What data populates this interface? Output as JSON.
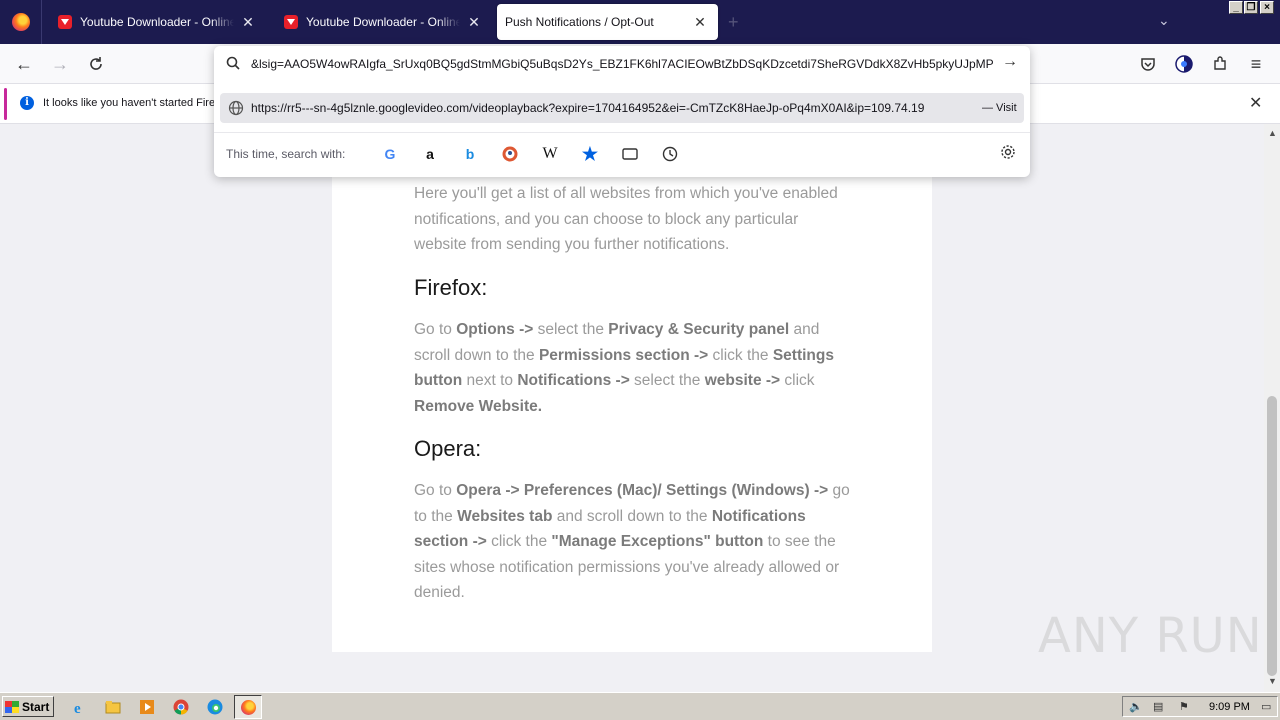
{
  "browser": {
    "tabs": [
      {
        "title": "Youtube Downloader - Online Youtube",
        "active": false
      },
      {
        "title": "Youtube Downloader - Online Youtube",
        "active": false
      },
      {
        "title": "Push Notifications / Opt-Out",
        "active": true
      }
    ],
    "newtab_glyph": "+",
    "close_glyph": "✕"
  },
  "urlbar": {
    "typed_text": "&lsig=AAO5W4owRAIgfa_SrUxq0BQ5gdStmMGbiQ5uBqsD2Ys_EBZ1FK6hl7ACIEOwBtZbDSqKDzcetdi7SheRGVDdkX8ZvHb5pkyUJpMP",
    "suggestion_url": "https://rr5---sn-4g5lznle.googlevideo.com/videoplayback?expire=1704164952&ei=-CmTZcK8HaeJp-oPq4mX0AI&ip=109.74.19",
    "visit_label": "— Visit",
    "search_with_label": "This time, search with:",
    "engines": [
      "google-icon",
      "amazon-icon",
      "bing-icon",
      "duckduckgo-icon",
      "wikipedia-icon",
      "bookmarks-icon",
      "tabs-icon",
      "history-icon"
    ]
  },
  "notification": {
    "message": "It looks like you haven't started Fire"
  },
  "page": {
    "intro": "Here you'll get a list of all websites from which you've enabled notifications, and you can choose to block any particular website from sending you further notifications.",
    "firefox_heading": "Firefox:",
    "firefox_parts": [
      "Go to ",
      "Options ->",
      " select the ",
      "Privacy & Security panel",
      " and scroll down to the ",
      "Permissions section ->",
      " click the ",
      "Settings button",
      " next to ",
      "Notifications ->",
      " select the ",
      "website ->",
      " click ",
      "Remove Website."
    ],
    "opera_heading": "Opera:",
    "opera_parts": [
      "Go to ",
      "Opera -> Preferences (Mac)/ Settings (Windows) ->",
      " go to the ",
      "Websites tab",
      " and scroll down to the ",
      "Notifications section ->",
      " click the ",
      "\"Manage Exceptions\" button",
      " to see the sites whose notification permissions you've already allowed or denied."
    ]
  },
  "watermark": "ANY RUN",
  "taskbar": {
    "start_label": "Start",
    "clock": "9:09 PM",
    "apps": [
      "ie-icon",
      "explorer-icon",
      "media-player-icon",
      "chrome-icon",
      "edge-icon",
      "firefox-icon"
    ]
  }
}
